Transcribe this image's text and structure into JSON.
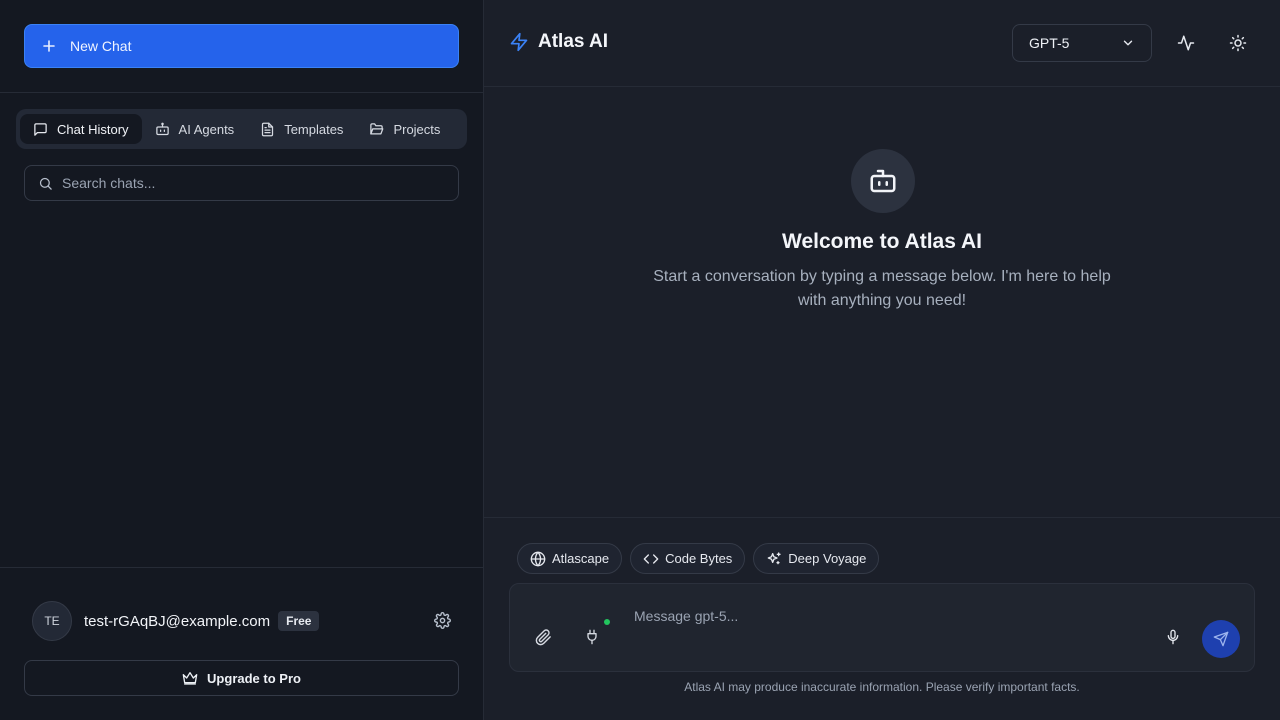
{
  "sidebar": {
    "new_chat_label": "New Chat",
    "tabs": [
      {
        "label": "Chat History",
        "icon": "message-square-icon",
        "active": true
      },
      {
        "label": "AI Agents",
        "icon": "bot-icon",
        "active": false
      },
      {
        "label": "Templates",
        "icon": "file-text-icon",
        "active": false
      },
      {
        "label": "Projects",
        "icon": "folder-icon",
        "active": false
      }
    ],
    "search_placeholder": "Search chats...",
    "user": {
      "initials": "TE",
      "email": "test-rGAqBJ@example.com",
      "plan_badge": "Free"
    },
    "upgrade_label": "Upgrade to Pro"
  },
  "header": {
    "app_title": "Atlas AI",
    "model": "GPT-5"
  },
  "welcome": {
    "title": "Welcome to Atlas AI",
    "subtitle": "Start a conversation by typing a message below. I'm here to help with anything you need!"
  },
  "composer": {
    "chips": [
      {
        "label": "Atlascape",
        "icon": "globe-icon"
      },
      {
        "label": "Code Bytes",
        "icon": "code-icon"
      },
      {
        "label": "Deep Voyage",
        "icon": "sparkles-icon"
      }
    ],
    "placeholder": "Message gpt-5...",
    "disclaimer": "Atlas AI may produce inaccurate information. Please verify important facts."
  },
  "colors": {
    "accent": "#2563eb",
    "online": "#22c55e",
    "background": "#1b1f29",
    "sidebar_bg": "#141821"
  }
}
